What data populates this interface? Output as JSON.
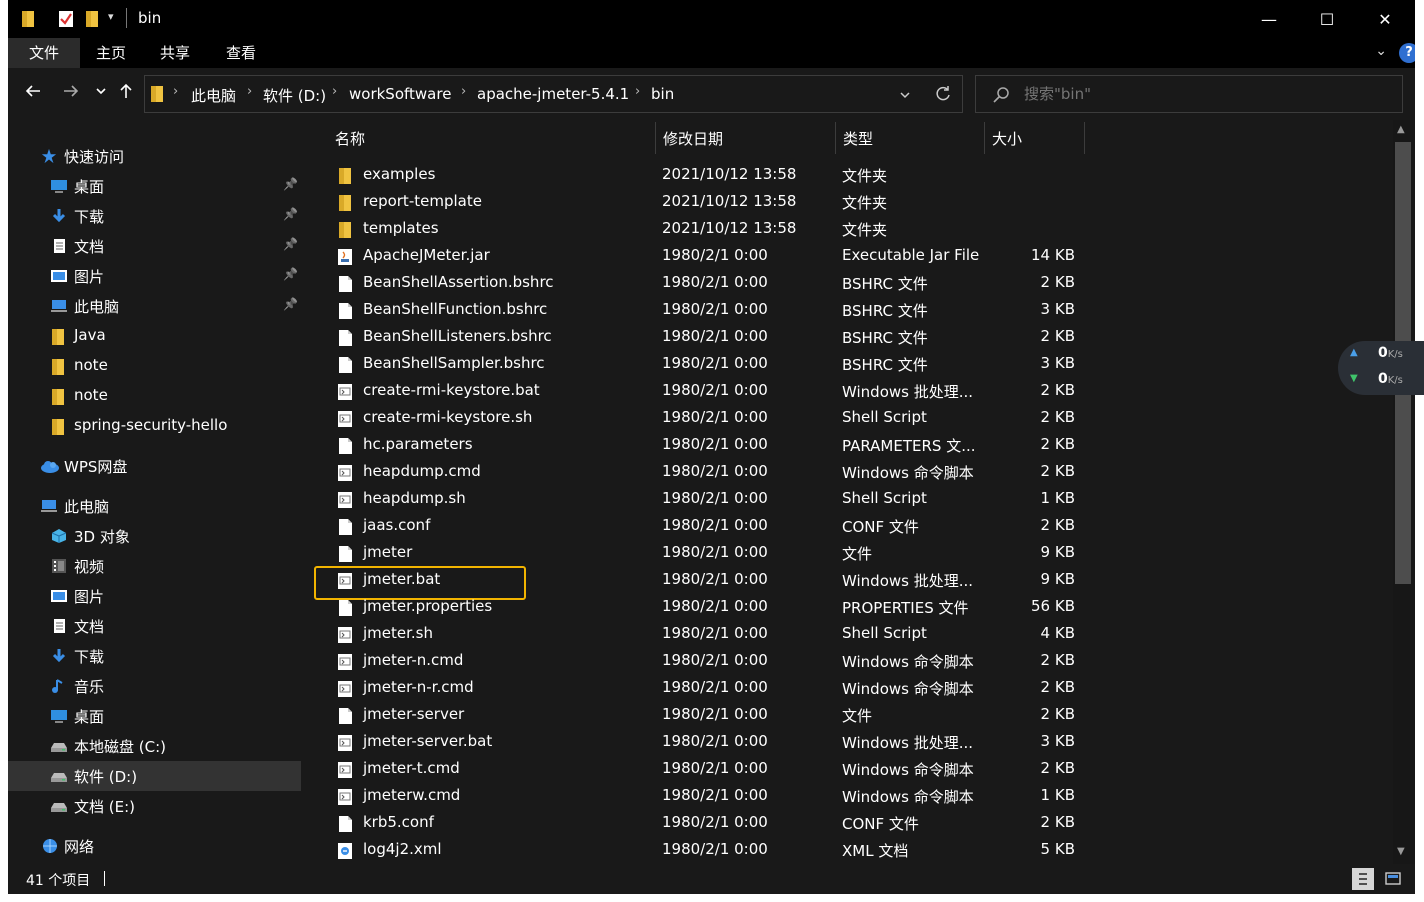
{
  "window": {
    "title": "bin",
    "controls": {
      "minimize": "—",
      "maximize": "☐",
      "close": "✕"
    }
  },
  "ribbon": {
    "tabs": [
      {
        "label": "文件",
        "active": true
      },
      {
        "label": "主页",
        "active": false
      },
      {
        "label": "共享",
        "active": false
      },
      {
        "label": "查看",
        "active": false
      }
    ],
    "help_label": "?"
  },
  "address": {
    "crumbs": [
      "此电脑",
      "软件 (D:)",
      "workSoftware",
      "apache-jmeter-5.4.1",
      "bin"
    ]
  },
  "search": {
    "placeholder": "搜索\"bin\""
  },
  "sidebar": {
    "items": [
      {
        "label": "快速访问",
        "icon": "star-icon",
        "pinned": false,
        "level": 0
      },
      {
        "label": "桌面",
        "icon": "desktop-icon",
        "pinned": true,
        "level": 1
      },
      {
        "label": "下载",
        "icon": "download-icon",
        "pinned": true,
        "level": 1
      },
      {
        "label": "文档",
        "icon": "document-icon",
        "pinned": true,
        "level": 1
      },
      {
        "label": "图片",
        "icon": "pictures-icon",
        "pinned": true,
        "level": 1
      },
      {
        "label": "此电脑",
        "icon": "computer-icon",
        "pinned": true,
        "level": 1
      },
      {
        "label": "Java",
        "icon": "folder-icon",
        "pinned": false,
        "level": 1
      },
      {
        "label": "note",
        "icon": "folder-icon",
        "pinned": false,
        "level": 1
      },
      {
        "label": "note",
        "icon": "folder-icon",
        "pinned": false,
        "level": 1
      },
      {
        "label": "spring-security-hello",
        "icon": "folder-icon",
        "pinned": false,
        "level": 1
      },
      {
        "label": "WPS网盘",
        "icon": "cloud-icon",
        "pinned": false,
        "level": 0
      },
      {
        "label": "此电脑",
        "icon": "computer-icon",
        "pinned": false,
        "level": 0
      },
      {
        "label": "3D 对象",
        "icon": "3d-objects-icon",
        "pinned": false,
        "level": 1
      },
      {
        "label": "视频",
        "icon": "video-icon",
        "pinned": false,
        "level": 1
      },
      {
        "label": "图片",
        "icon": "pictures-icon",
        "pinned": false,
        "level": 1
      },
      {
        "label": "文档",
        "icon": "document-icon",
        "pinned": false,
        "level": 1
      },
      {
        "label": "下载",
        "icon": "download-icon",
        "pinned": false,
        "level": 1
      },
      {
        "label": "音乐",
        "icon": "music-icon",
        "pinned": false,
        "level": 1
      },
      {
        "label": "桌面",
        "icon": "desktop-icon",
        "pinned": false,
        "level": 1
      },
      {
        "label": "本地磁盘 (C:)",
        "icon": "drive-icon",
        "pinned": false,
        "level": 1
      },
      {
        "label": "软件 (D:)",
        "icon": "drive-icon",
        "pinned": false,
        "level": 1,
        "selected": true
      },
      {
        "label": "文档 (E:)",
        "icon": "drive-icon",
        "pinned": false,
        "level": 1
      },
      {
        "label": "网络",
        "icon": "network-icon",
        "pinned": false,
        "level": 0
      }
    ]
  },
  "columns": {
    "name": "名称",
    "date": "修改日期",
    "type": "类型",
    "size": "大小"
  },
  "files": [
    {
      "name": "examples",
      "date": "2021/10/12 13:58",
      "type": "文件夹",
      "size": "",
      "icon": "folder-icon"
    },
    {
      "name": "report-template",
      "date": "2021/10/12 13:58",
      "type": "文件夹",
      "size": "",
      "icon": "folder-icon"
    },
    {
      "name": "templates",
      "date": "2021/10/12 13:58",
      "type": "文件夹",
      "size": "",
      "icon": "folder-icon"
    },
    {
      "name": "ApacheJMeter.jar",
      "date": "1980/2/1 0:00",
      "type": "Executable Jar File",
      "size": "14 KB",
      "icon": "jar-icon"
    },
    {
      "name": "BeanShellAssertion.bshrc",
      "date": "1980/2/1 0:00",
      "type": "BSHRC 文件",
      "size": "2 KB",
      "icon": "file-icon"
    },
    {
      "name": "BeanShellFunction.bshrc",
      "date": "1980/2/1 0:00",
      "type": "BSHRC 文件",
      "size": "3 KB",
      "icon": "file-icon"
    },
    {
      "name": "BeanShellListeners.bshrc",
      "date": "1980/2/1 0:00",
      "type": "BSHRC 文件",
      "size": "2 KB",
      "icon": "file-icon"
    },
    {
      "name": "BeanShellSampler.bshrc",
      "date": "1980/2/1 0:00",
      "type": "BSHRC 文件",
      "size": "3 KB",
      "icon": "file-icon"
    },
    {
      "name": "create-rmi-keystore.bat",
      "date": "1980/2/1 0:00",
      "type": "Windows 批处理...",
      "size": "2 KB",
      "icon": "script-icon"
    },
    {
      "name": "create-rmi-keystore.sh",
      "date": "1980/2/1 0:00",
      "type": "Shell Script",
      "size": "2 KB",
      "icon": "script-icon"
    },
    {
      "name": "hc.parameters",
      "date": "1980/2/1 0:00",
      "type": "PARAMETERS 文...",
      "size": "2 KB",
      "icon": "file-icon"
    },
    {
      "name": "heapdump.cmd",
      "date": "1980/2/1 0:00",
      "type": "Windows 命令脚本",
      "size": "2 KB",
      "icon": "script-icon"
    },
    {
      "name": "heapdump.sh",
      "date": "1980/2/1 0:00",
      "type": "Shell Script",
      "size": "1 KB",
      "icon": "script-icon"
    },
    {
      "name": "jaas.conf",
      "date": "1980/2/1 0:00",
      "type": "CONF 文件",
      "size": "2 KB",
      "icon": "file-icon"
    },
    {
      "name": "jmeter",
      "date": "1980/2/1 0:00",
      "type": "文件",
      "size": "9 KB",
      "icon": "file-icon"
    },
    {
      "name": "jmeter.bat",
      "date": "1980/2/1 0:00",
      "type": "Windows 批处理...",
      "size": "9 KB",
      "icon": "script-icon",
      "highlighted": true
    },
    {
      "name": "jmeter.properties",
      "date": "1980/2/1 0:00",
      "type": "PROPERTIES 文件",
      "size": "56 KB",
      "icon": "file-icon"
    },
    {
      "name": "jmeter.sh",
      "date": "1980/2/1 0:00",
      "type": "Shell Script",
      "size": "4 KB",
      "icon": "script-icon"
    },
    {
      "name": "jmeter-n.cmd",
      "date": "1980/2/1 0:00",
      "type": "Windows 命令脚本",
      "size": "2 KB",
      "icon": "script-icon"
    },
    {
      "name": "jmeter-n-r.cmd",
      "date": "1980/2/1 0:00",
      "type": "Windows 命令脚本",
      "size": "2 KB",
      "icon": "script-icon"
    },
    {
      "name": "jmeter-server",
      "date": "1980/2/1 0:00",
      "type": "文件",
      "size": "2 KB",
      "icon": "file-icon"
    },
    {
      "name": "jmeter-server.bat",
      "date": "1980/2/1 0:00",
      "type": "Windows 批处理...",
      "size": "3 KB",
      "icon": "script-icon"
    },
    {
      "name": "jmeter-t.cmd",
      "date": "1980/2/1 0:00",
      "type": "Windows 命令脚本",
      "size": "2 KB",
      "icon": "script-icon"
    },
    {
      "name": "jmeterw.cmd",
      "date": "1980/2/1 0:00",
      "type": "Windows 命令脚本",
      "size": "1 KB",
      "icon": "script-icon"
    },
    {
      "name": "krb5.conf",
      "date": "1980/2/1 0:00",
      "type": "CONF 文件",
      "size": "2 KB",
      "icon": "file-icon"
    },
    {
      "name": "log4j2.xml",
      "date": "1980/2/1 0:00",
      "type": "XML 文档",
      "size": "5 KB",
      "icon": "xml-icon"
    }
  ],
  "status": {
    "item_count": "41 个项目"
  },
  "net_widget": {
    "up": "0",
    "down": "0",
    "unit": "K/s"
  },
  "colors": {
    "highlight": "#f2b400",
    "accent": "#2f6fd1",
    "folder": "#f0c341"
  }
}
